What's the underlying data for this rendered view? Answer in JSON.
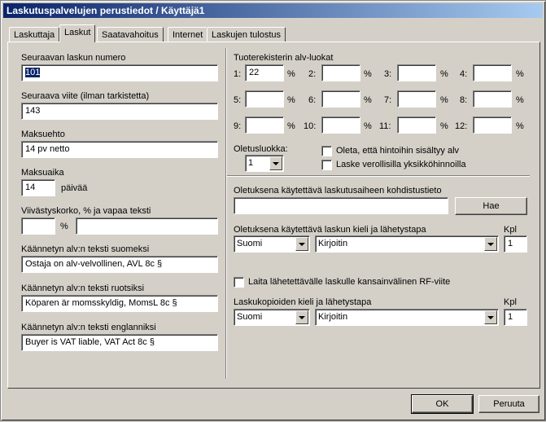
{
  "window": {
    "title": "Laskutuspalvelujen perustiedot / Käyttäjä1"
  },
  "tabs": [
    {
      "label": "Laskuttaja"
    },
    {
      "label": "Laskut"
    },
    {
      "label": "Saatavahoitus"
    },
    {
      "label": "Internet"
    },
    {
      "label": "Laskujen tulostus"
    }
  ],
  "left": {
    "next_invoice_label": "Seuraavan laskun numero",
    "next_invoice_value": "101",
    "next_ref_label": "Seuraava viite (ilman tarkistetta)",
    "next_ref_value": "143",
    "terms_label": "Maksuehto",
    "terms_value": "14 pv netto",
    "payment_time_label": "Maksuaika",
    "payment_time_value": "14",
    "payment_time_unit": "päivää",
    "interest_label": "Viivästyskorko, % ja vapaa teksti",
    "interest_value": "",
    "interest_unit": "%",
    "interest_text": "",
    "vat_fi_label": "Käännetyn alv:n teksti suomeksi",
    "vat_fi_value": "Ostaja on alv-velvollinen, AVL 8c §",
    "vat_sv_label": "Käännetyn alv:n teksti ruotsiksi",
    "vat_sv_value": "Köparen är momsskyldig, MomsL 8c §",
    "vat_en_label": "Käännetyn alv:n teksti englanniksi",
    "vat_en_value": "Buyer is VAT liable, VAT Act 8c §"
  },
  "vat": {
    "title": "Tuoterekisterin alv-luokat",
    "unit": "%",
    "classes": [
      {
        "num": "1:",
        "value": "22"
      },
      {
        "num": "2:",
        "value": ""
      },
      {
        "num": "3:",
        "value": ""
      },
      {
        "num": "4:",
        "value": ""
      },
      {
        "num": "5:",
        "value": ""
      },
      {
        "num": "6:",
        "value": ""
      },
      {
        "num": "7:",
        "value": ""
      },
      {
        "num": "8:",
        "value": ""
      },
      {
        "num": "9:",
        "value": ""
      },
      {
        "num": "10:",
        "value": ""
      },
      {
        "num": "11:",
        "value": ""
      },
      {
        "num": "12:",
        "value": ""
      }
    ],
    "default_class_label": "Oletusluokka:",
    "default_class_value": "1",
    "check_prices_incl": "Oleta, että hintoihin sisältyy alv",
    "check_taxable_units": "Laske verollisilla yksikköhinnoilla"
  },
  "right": {
    "default_subject_label": "Oletuksena käytettävä laskutusaiheen kohdistustieto",
    "default_subject_value": "",
    "fetch_button": "Hae",
    "lang_method_label": "Oletuksena käytettävä laskun kieli ja lähetystapa",
    "qty_label": "Kpl",
    "language_value": "Suomi",
    "method_value": "Kirjoitin",
    "qty_value": "1",
    "rf_check_label": "Laita lähetettävälle laskulle kansainvälinen RF-viite",
    "copies_label": "Laskukopioiden kieli ja lähetystapa",
    "copies_qty_label": "Kpl",
    "copies_language_value": "Suomi",
    "copies_method_value": "Kirjoitin",
    "copies_qty_value": "1"
  },
  "footer": {
    "ok_label": "OK",
    "cancel_label": "Peruuta"
  }
}
